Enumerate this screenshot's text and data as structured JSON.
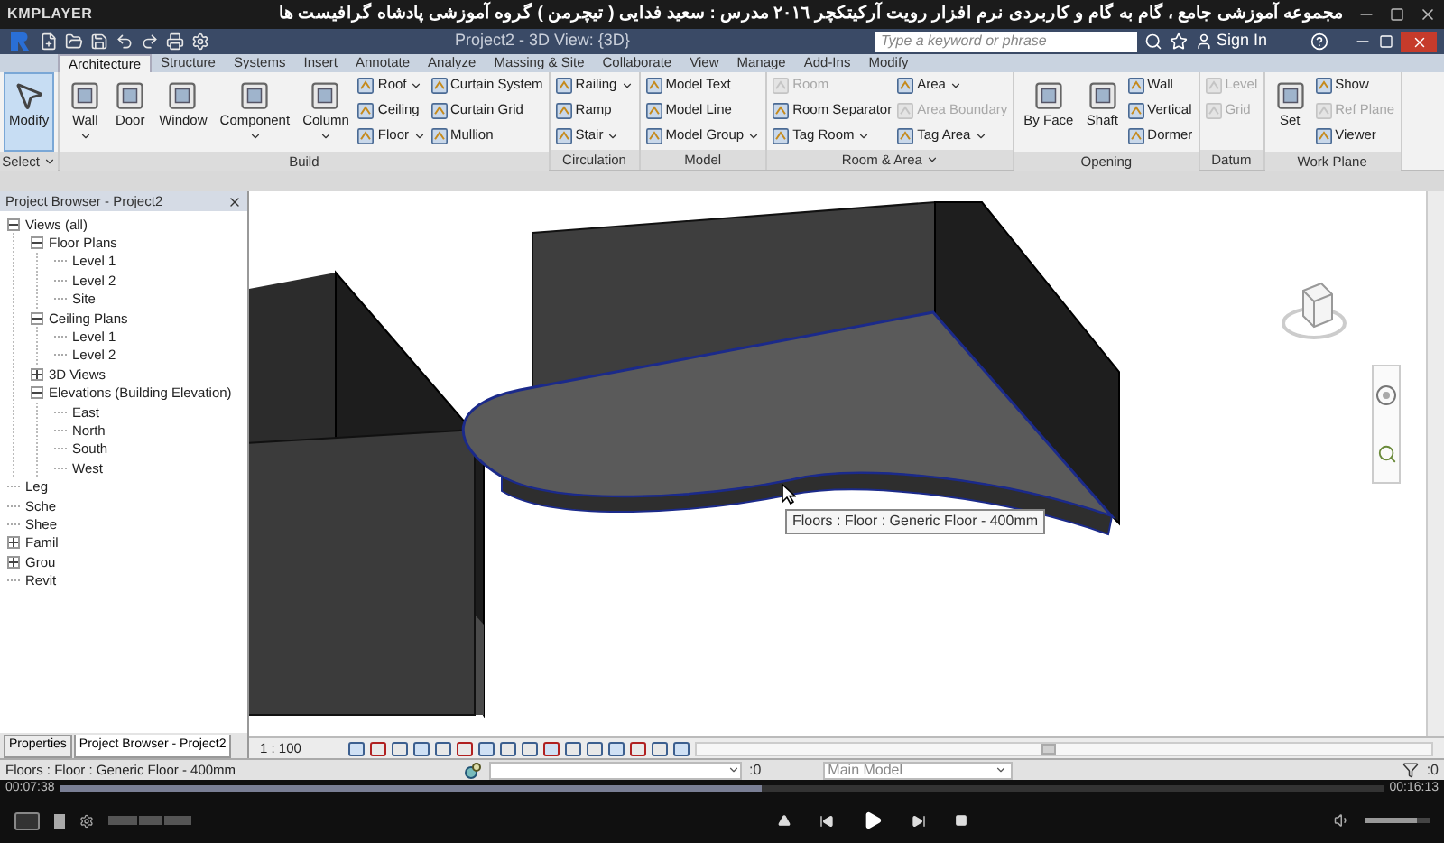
{
  "player": {
    "name": "KMPLAYER",
    "title": "مجموعه آموزشی جامع ، گام به گام و کاربردی نرم افزار رویت آرکیتکچر ٢٠١٦   مدرس : سعید فدایی ( تیچرمن ) گروه آموزشی پادشاه گرافیست ها",
    "current_time": "00:07:38",
    "total_time": "00:16:13",
    "progress": {
      "level": 0.53
    },
    "volume": {
      "level": 0.8
    }
  },
  "revit": {
    "view_title": "Project2 - 3D View: {3D}",
    "search": {
      "placeholder": "Type a keyword or phrase"
    },
    "sign_in": "Sign In"
  },
  "tabs": [
    {
      "label": "Architecture",
      "selected": true
    },
    {
      "label": "Structure",
      "selected": false
    },
    {
      "label": "Systems",
      "selected": false
    },
    {
      "label": "Insert",
      "selected": false
    },
    {
      "label": "Annotate",
      "selected": false
    },
    {
      "label": "Analyze",
      "selected": false
    },
    {
      "label": "Massing & Site",
      "selected": false
    },
    {
      "label": "Collaborate",
      "selected": false
    },
    {
      "label": "View",
      "selected": false
    },
    {
      "label": "Manage",
      "selected": false
    },
    {
      "label": "Add-Ins",
      "selected": false
    },
    {
      "label": "Modify",
      "selected": false
    }
  ],
  "panels": [
    {
      "label": "Select",
      "menu": true,
      "columns": [
        [
          {
            "label": "Modify",
            "kind": "large",
            "menu": false,
            "disabled": false,
            "selected": true
          }
        ]
      ]
    },
    {
      "label": "Build",
      "menu": false,
      "columns": [
        [
          {
            "label": "Wall",
            "kind": "large",
            "menu": true,
            "disabled": false,
            "selected": false
          }
        ],
        [
          {
            "label": "Door",
            "kind": "large",
            "menu": false,
            "disabled": false,
            "selected": false
          }
        ],
        [
          {
            "label": "Window",
            "kind": "large",
            "menu": false,
            "disabled": false,
            "selected": false
          }
        ],
        [
          {
            "label": "Component",
            "kind": "large",
            "menu": true,
            "disabled": false,
            "selected": false
          }
        ],
        [
          {
            "label": "Column",
            "kind": "large",
            "menu": true,
            "disabled": false,
            "selected": false
          }
        ],
        [
          {
            "label": "Roof",
            "kind": "small",
            "menu": true,
            "disabled": false,
            "selected": false
          },
          {
            "label": "Ceiling",
            "kind": "small",
            "menu": false,
            "disabled": false,
            "selected": false
          },
          {
            "label": "Floor",
            "kind": "small",
            "menu": true,
            "disabled": false,
            "selected": false
          }
        ],
        [
          {
            "label": "Curtain System",
            "kind": "small",
            "menu": false,
            "disabled": false,
            "selected": false
          },
          {
            "label": "Curtain Grid",
            "kind": "small",
            "menu": false,
            "disabled": false,
            "selected": false
          },
          {
            "label": "Mullion",
            "kind": "small",
            "menu": false,
            "disabled": false,
            "selected": false
          }
        ]
      ]
    },
    {
      "label": "Circulation",
      "menu": false,
      "columns": [
        [
          {
            "label": "Railing",
            "kind": "small",
            "menu": true,
            "disabled": false,
            "selected": false
          },
          {
            "label": "Ramp",
            "kind": "small",
            "menu": false,
            "disabled": false,
            "selected": false
          },
          {
            "label": "Stair",
            "kind": "small",
            "menu": true,
            "disabled": false,
            "selected": false
          }
        ]
      ]
    },
    {
      "label": "Model",
      "menu": false,
      "columns": [
        [
          {
            "label": "Model Text",
            "kind": "small",
            "menu": false,
            "disabled": false,
            "selected": false
          },
          {
            "label": "Model Line",
            "kind": "small",
            "menu": false,
            "disabled": false,
            "selected": false
          },
          {
            "label": "Model Group",
            "kind": "small",
            "menu": true,
            "disabled": false,
            "selected": false
          }
        ]
      ]
    },
    {
      "label": "Room & Area",
      "menu": true,
      "columns": [
        [
          {
            "label": "Room",
            "kind": "small",
            "menu": false,
            "disabled": true,
            "selected": false
          },
          {
            "label": "Room Separator",
            "kind": "small",
            "menu": false,
            "disabled": false,
            "selected": false
          },
          {
            "label": "Tag Room",
            "kind": "small",
            "menu": true,
            "disabled": false,
            "selected": false
          }
        ],
        [
          {
            "label": "Area",
            "kind": "small",
            "menu": true,
            "disabled": false,
            "selected": false
          },
          {
            "label": "Area Boundary",
            "kind": "small",
            "menu": false,
            "disabled": true,
            "selected": false
          },
          {
            "label": "Tag Area",
            "kind": "small",
            "menu": true,
            "disabled": false,
            "selected": false
          }
        ]
      ]
    },
    {
      "label": "Opening",
      "menu": false,
      "columns": [
        [
          {
            "label": "By Face",
            "kind": "large",
            "menu": false,
            "disabled": false,
            "selected": false
          }
        ],
        [
          {
            "label": "Shaft",
            "kind": "large",
            "menu": false,
            "disabled": false,
            "selected": false
          }
        ],
        [
          {
            "label": "Wall",
            "kind": "small",
            "menu": false,
            "disabled": false,
            "selected": false
          },
          {
            "label": "Vertical",
            "kind": "small",
            "menu": false,
            "disabled": false,
            "selected": false
          },
          {
            "label": "Dormer",
            "kind": "small",
            "menu": false,
            "disabled": false,
            "selected": false
          }
        ]
      ]
    },
    {
      "label": "Datum",
      "menu": false,
      "columns": [
        [
          {
            "label": "Level",
            "kind": "small",
            "menu": false,
            "disabled": true,
            "selected": false
          },
          {
            "label": "Grid",
            "kind": "small",
            "menu": false,
            "disabled": true,
            "selected": false
          }
        ]
      ]
    },
    {
      "label": "Work Plane",
      "menu": false,
      "columns": [
        [
          {
            "label": "Set",
            "kind": "large",
            "menu": false,
            "disabled": false,
            "selected": false
          }
        ],
        [
          {
            "label": "Show",
            "kind": "small",
            "menu": false,
            "disabled": false,
            "selected": false
          },
          {
            "label": "Ref Plane",
            "kind": "small",
            "menu": false,
            "disabled": true,
            "selected": false
          },
          {
            "label": "Viewer",
            "kind": "small",
            "menu": false,
            "disabled": false,
            "selected": false
          }
        ]
      ]
    }
  ],
  "project_browser": {
    "title": "Project Browser - Project2",
    "tree": [
      {
        "label": "Views (all)",
        "expanded": true,
        "children": [
          {
            "label": "Floor Plans",
            "expanded": true,
            "children": [
              {
                "label": "Level 1"
              },
              {
                "label": "Level 2"
              },
              {
                "label": "Site"
              }
            ]
          },
          {
            "label": "Ceiling Plans",
            "expanded": true,
            "children": [
              {
                "label": "Level 1"
              },
              {
                "label": "Level 2"
              }
            ]
          },
          {
            "label": "3D Views",
            "expanded": false
          },
          {
            "label": "Elevations (Building Elevation)",
            "expanded": true,
            "children": [
              {
                "label": "East"
              },
              {
                "label": "North"
              },
              {
                "label": "South"
              },
              {
                "label": "West"
              }
            ]
          }
        ]
      },
      {
        "label": "Leg"
      },
      {
        "label": "Sche"
      },
      {
        "label": "Shee"
      },
      {
        "label": "Famil",
        "expanded": false
      },
      {
        "label": "Grou",
        "expanded": false
      },
      {
        "label": "Revit"
      }
    ],
    "tabs": [
      {
        "label": "Properties",
        "selected": false
      },
      {
        "label": "Project Browser - Project2",
        "selected": true
      }
    ]
  },
  "viewport": {
    "tooltip": "Floors : Floor : Generic Floor - 400mm",
    "scale": "1 : 100"
  },
  "status_bar": {
    "message": "Floors : Floor : Generic Floor - 400mm",
    "editable_count": ":0",
    "design_option": "Main Model",
    "filter_count": ":0"
  }
}
